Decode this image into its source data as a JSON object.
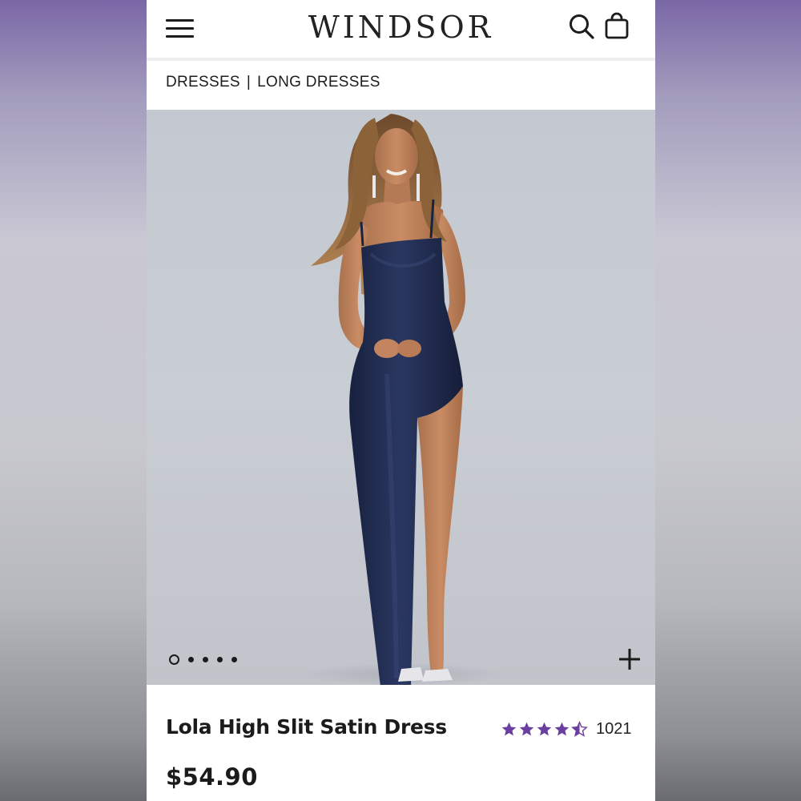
{
  "header": {
    "brand": "WINDSOR",
    "menu_icon": "hamburger-menu-icon",
    "search_icon": "search-icon",
    "bag_icon": "shopping-bag-icon"
  },
  "breadcrumb": {
    "items": [
      {
        "label": "DRESSES"
      },
      {
        "label": "LONG DRESSES"
      }
    ],
    "separator": "|"
  },
  "gallery": {
    "image_description_icon": "product-photo",
    "dots_total": 5,
    "active_dot_index": 0,
    "zoom_icon": "plus-icon"
  },
  "product": {
    "name": "Lola High Slit Satin Dress",
    "price": "$54.90",
    "rating": {
      "value": 4.5,
      "max": 5,
      "review_count": "1021",
      "star_color": "#6b3fa0"
    }
  },
  "colors": {
    "dress": "#1f2a4a",
    "background": "#c7cbd2",
    "text": "#1b1b1b"
  }
}
